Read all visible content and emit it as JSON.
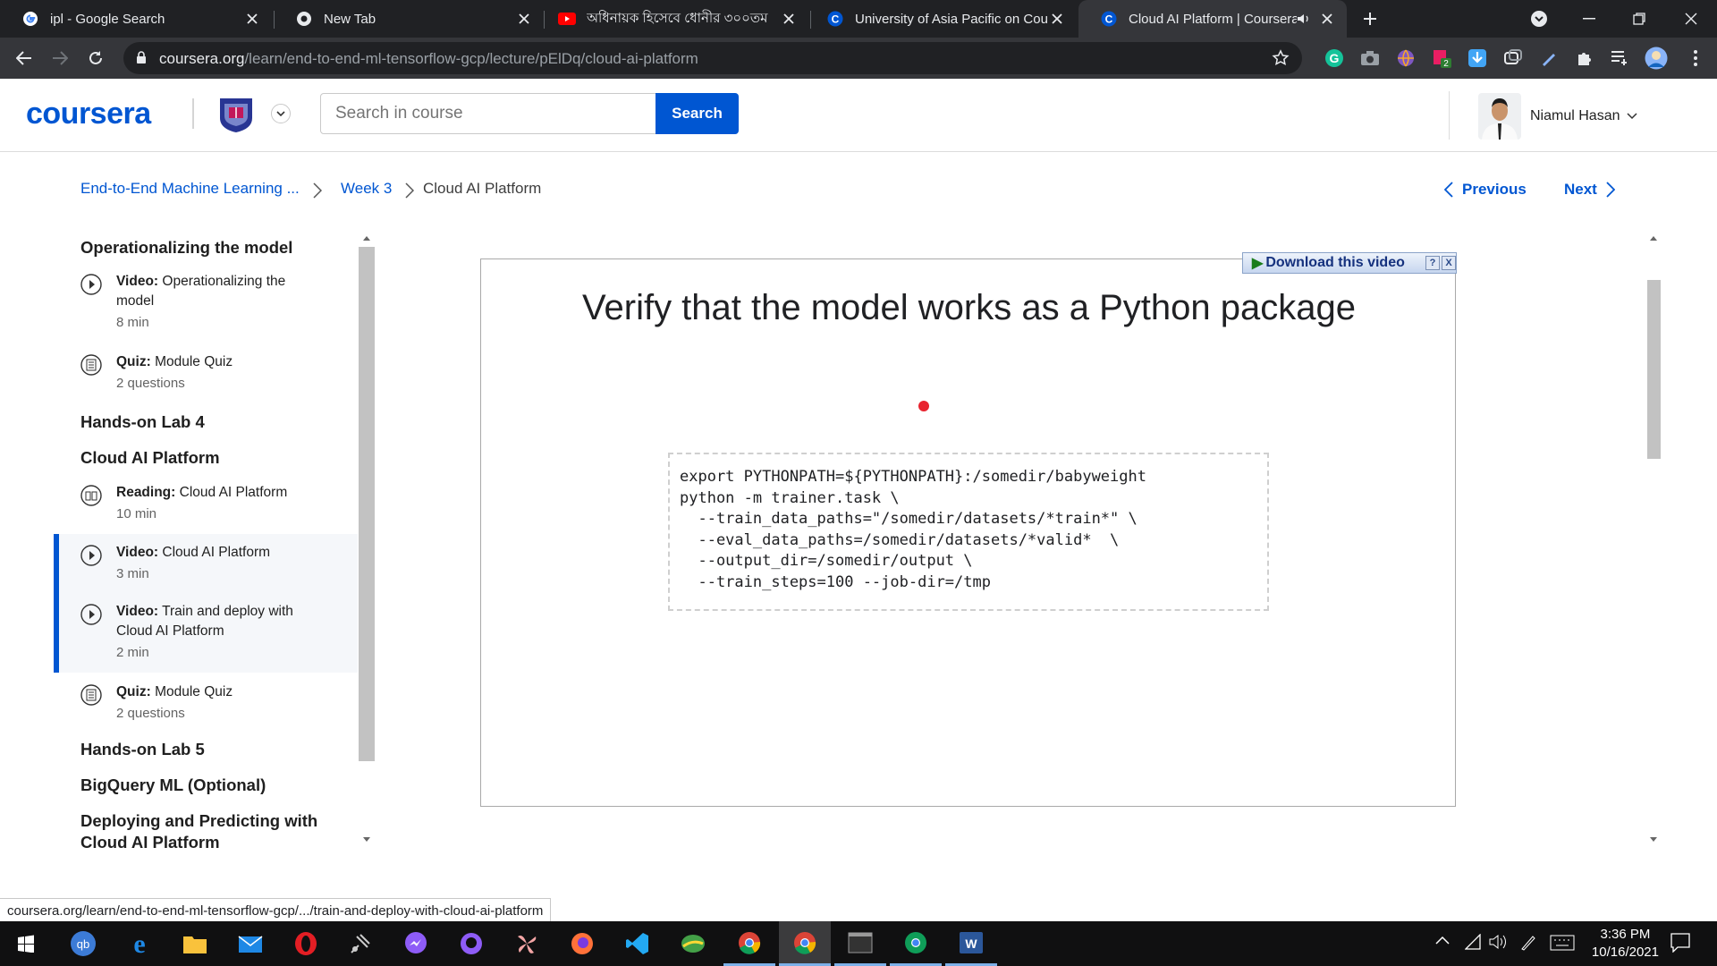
{
  "browser": {
    "tabs": [
      {
        "title": "ipl - Google Search",
        "icon": "google-icon"
      },
      {
        "title": "New Tab",
        "icon": "chrome-icon"
      },
      {
        "title": "অধিনায়ক হিসেবে ধোনীর ৩০০তম",
        "icon": "youtube-icon"
      },
      {
        "title": "University of Asia Pacific on Cour",
        "icon": "coursera-icon"
      },
      {
        "title": "Cloud AI Platform | Coursera",
        "icon": "coursera-icon",
        "active": true
      }
    ],
    "url_host": "coursera.org",
    "url_path": "/learn/end-to-end-ml-tensorflow-gcp/lecture/pElDq/cloud-ai-platform",
    "extension_badge": "2"
  },
  "header": {
    "logo": "coursera",
    "search_placeholder": "Search in course",
    "search_button": "Search",
    "user_name": "Niamul Hasan"
  },
  "breadcrumb": {
    "course": "End-to-End Machine Learning ...",
    "week": "Week 3",
    "current": "Cloud AI Platform"
  },
  "nav": {
    "previous": "Previous",
    "next": "Next"
  },
  "sidebar": {
    "section1": "Operationalizing the model",
    "item1": {
      "type": "Video:",
      "title": "Operationalizing the model",
      "meta": "8 min"
    },
    "item2": {
      "type": "Quiz:",
      "title": "Module Quiz",
      "meta": "2 questions"
    },
    "section2": "Hands-on Lab 4",
    "section3": "Cloud AI Platform",
    "item3": {
      "type": "Reading:",
      "title": "Cloud AI Platform",
      "meta": "10 min"
    },
    "item4": {
      "type": "Video:",
      "title": "Cloud AI Platform",
      "meta": "3 min"
    },
    "item5": {
      "type": "Video:",
      "title": "Train and deploy with Cloud AI Platform",
      "meta": "2 min"
    },
    "item6": {
      "type": "Quiz:",
      "title": "Module Quiz",
      "meta": "2 questions"
    },
    "section4": "Hands-on Lab 5",
    "section5": "BigQuery ML (Optional)",
    "section6": "Deploying and Predicting with Cloud AI Platform"
  },
  "video": {
    "slide_title": "Verify that the model works as a Python package",
    "download_label": "Download this video",
    "help": "?",
    "close": "X",
    "code": "export PYTHONPATH=${PYTHONPATH}:/somedir/babyweight\npython -m trainer.task \\\n  --train_data_paths=\"/somedir/datasets/*train*\" \\\n  --eval_data_paths=/somedir/datasets/*valid*  \\\n  --output_dir=/somedir/output \\\n  --train_steps=100 --job-dir=/tmp"
  },
  "status_url": "coursera.org/learn/end-to-end-ml-tensorflow-gcp/.../train-and-deploy-with-cloud-ai-platform",
  "taskbar": {
    "time": "3:36 PM",
    "date": "10/16/2021"
  }
}
